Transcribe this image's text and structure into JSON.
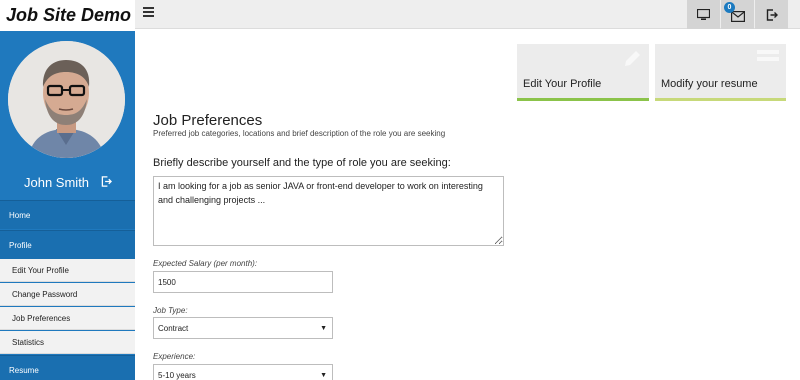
{
  "header": {
    "brand": "Job Site Demo",
    "notification_count": "0",
    "icons": [
      "menu-icon",
      "monitor-icon",
      "envelope-icon",
      "logout-icon"
    ]
  },
  "sidebar": {
    "user_name": "John Smith",
    "items": [
      {
        "label": "Home"
      },
      {
        "label": "Profile"
      }
    ],
    "profile_sub_items": [
      {
        "label": "Edit Your Profile"
      },
      {
        "label": "Change Password"
      },
      {
        "label": "Job Preferences"
      },
      {
        "label": "Statistics"
      }
    ],
    "resume_label": "Resume"
  },
  "cards": [
    {
      "label": "Edit Your Profile",
      "icon": "pencil-icon",
      "bar_color": "#8bc34a"
    },
    {
      "label": "Modify your resume",
      "icon": "list-icon",
      "bar_color": "#c7d97a"
    }
  ],
  "main": {
    "title": "Job Preferences",
    "subtitle": "Preferred job categories, locations and brief description of the role you are seeking",
    "description_question": "Briefly describe yourself and the type of role you are seeking:",
    "description_value": "I am looking for a job as senior JAVA or front-end developer to work on interesting and challenging projects ...",
    "salary_label": "Expected Salary (per month):",
    "salary_value": "1500",
    "job_type_label": "Job Type:",
    "job_type_value": "Contract",
    "experience_label": "Experience:",
    "experience_value": "5-10 years"
  },
  "colors": {
    "sidebar": "#1f79be",
    "topbar": "#eeeeee",
    "accent_green": "#8bc34a"
  }
}
